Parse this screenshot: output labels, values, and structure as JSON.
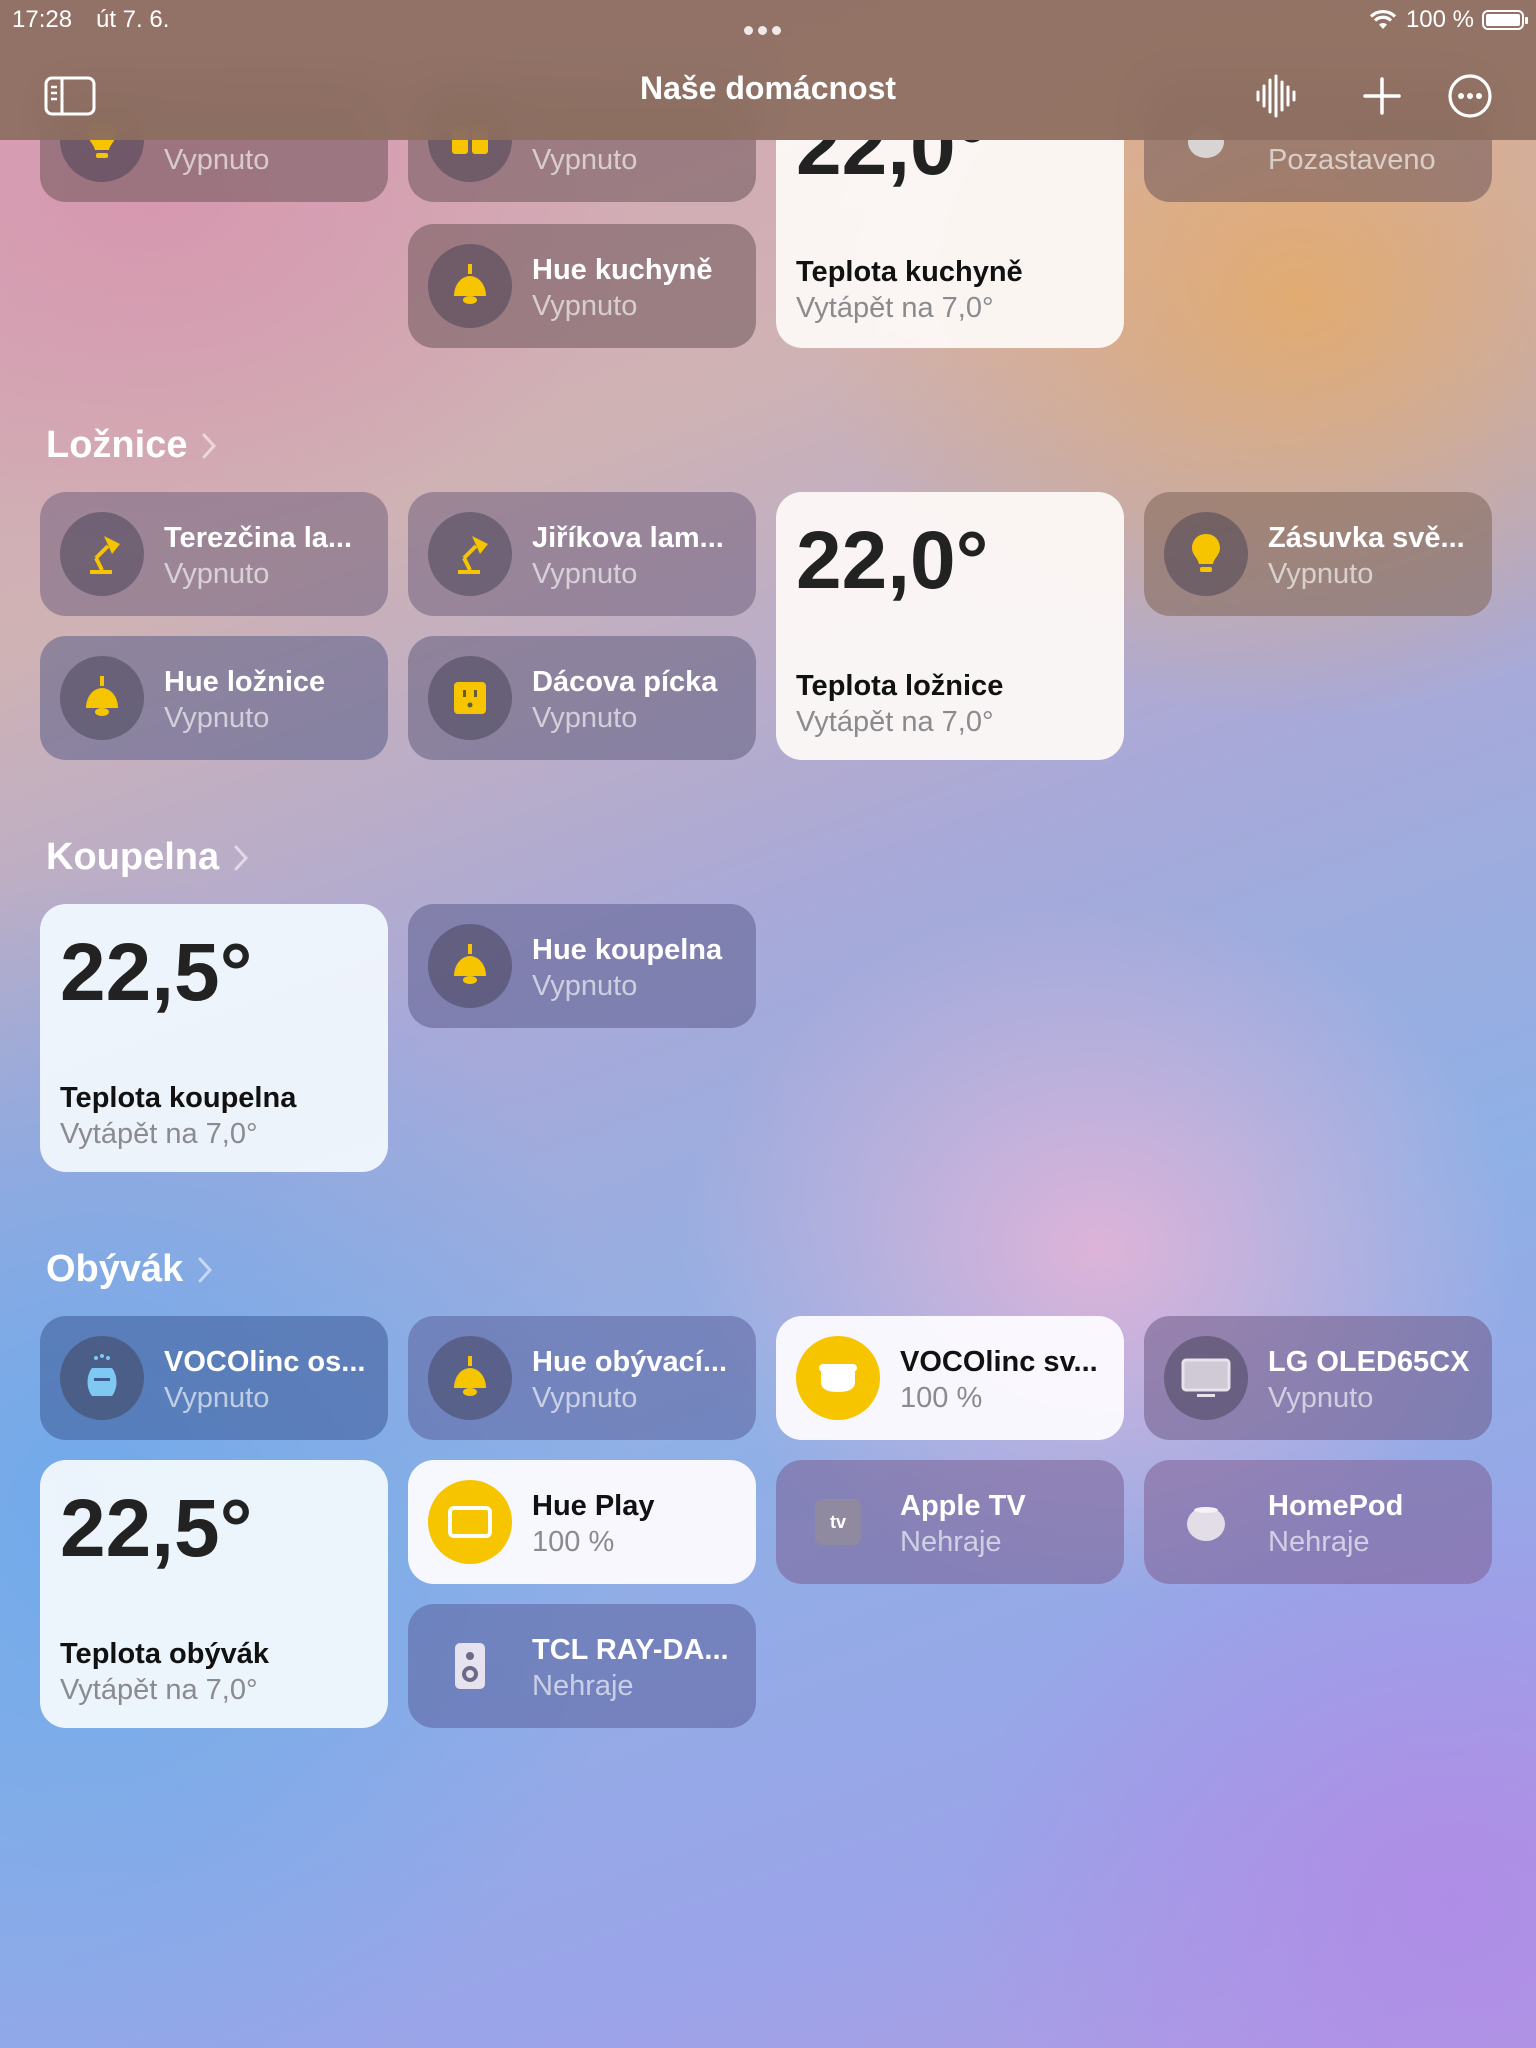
{
  "status": {
    "time": "17:28",
    "date": "út 7. 6.",
    "battery": "100 %",
    "battery_level": 1.0
  },
  "nav": {
    "title": "Naše domácnost"
  },
  "top_row": {
    "t1_state": "Vypnuto",
    "t2_state": "Vypnuto",
    "t3_temp": "22,0°",
    "t4_state": "Pozastaveno",
    "hue_kuchyne": {
      "name": "Hue kuchyně",
      "state": "Vypnuto"
    },
    "teplota_kuchyne": {
      "name": "Teplota kuchyně",
      "state": "Vytápět na 7,0°"
    }
  },
  "loznice": {
    "title": "Ložnice",
    "t1": {
      "name": "Terezčina la...",
      "state": "Vypnuto"
    },
    "t2": {
      "name": "Jiříkova lam...",
      "state": "Vypnuto"
    },
    "temp": {
      "value": "22,0°",
      "name": "Teplota ložnice",
      "state": "Vytápět na 7,0°"
    },
    "t4": {
      "name": "Zásuvka svě...",
      "state": "Vypnuto"
    },
    "t5": {
      "name": "Hue ložnice",
      "state": "Vypnuto"
    },
    "t6": {
      "name": "Dácova pícka",
      "state": "Vypnuto"
    }
  },
  "koupelna": {
    "title": "Koupelna",
    "temp": {
      "value": "22,5°",
      "name": "Teplota koupelna",
      "state": "Vytápět na 7,0°"
    },
    "t1": {
      "name": "Hue koupelna",
      "state": "Vypnuto"
    }
  },
  "obyvak": {
    "title": "Obývák",
    "t1": {
      "name": "VOCOlinc os...",
      "state": "Vypnuto"
    },
    "t2": {
      "name": "Hue obývací...",
      "state": "Vypnuto"
    },
    "t3": {
      "name": "VOCOlinc sv...",
      "state": "100 %"
    },
    "t4": {
      "name": "LG OLED65CX",
      "state": "Vypnuto"
    },
    "temp": {
      "value": "22,5°",
      "name": "Teplota obývák",
      "state": "Vytápět na 7,0°"
    },
    "t5": {
      "name": "Hue Play",
      "state": "100 %"
    },
    "t6": {
      "name": "Apple TV",
      "state": "Nehraje"
    },
    "t7": {
      "name": "HomePod",
      "state": "Nehraje"
    },
    "t8": {
      "name": "TCL RAY-DA...",
      "state": "Nehraje"
    }
  },
  "icons": {
    "appletv_badge": "tv"
  }
}
